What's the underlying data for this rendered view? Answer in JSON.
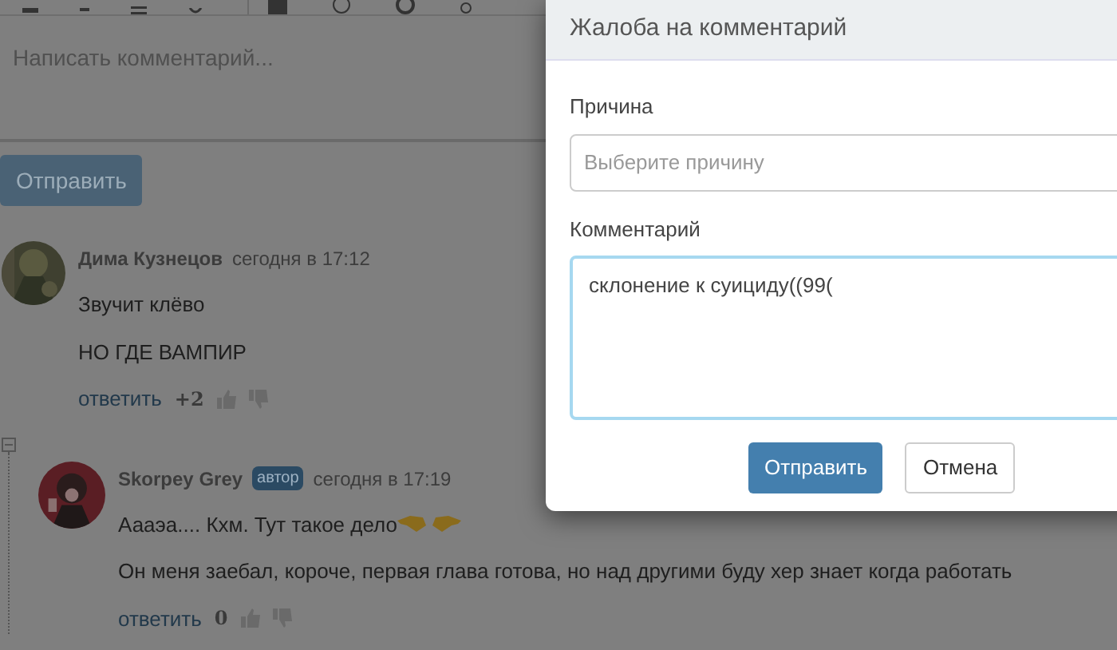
{
  "editor": {
    "placeholder": "Написать комментарий...",
    "submit": "Отправить"
  },
  "comments": [
    {
      "author": "Дима Кузнецов",
      "time": "сегодня в 17:12",
      "lines": [
        "Звучит клёво",
        "НО ГДЕ ВАМПИР"
      ],
      "reply": "ответить",
      "score": "+2",
      "expanded": true,
      "children": [
        {
          "author": "Skorpey Grey",
          "badge": "автор",
          "time": "сегодня в 17:19",
          "lines": [
            "Аааэа.... Кхм. Тут такое дело",
            "Он меня заебал, короче, первая глава готова, но над другими буду хер знает когда работать"
          ],
          "emoji": true,
          "reply": "ответить",
          "score": "0"
        }
      ]
    }
  ],
  "dialog": {
    "title": "Жалоба на комментарий",
    "fields": [
      {
        "kind": "select",
        "label": "Причина",
        "placeholder": "Выберите причину"
      },
      {
        "kind": "textarea",
        "label": "Комментарий",
        "value": "склонение к суициду((99(",
        "focused": true
      }
    ],
    "buttons": [
      {
        "label": "Отправить",
        "kind": "primary"
      },
      {
        "label": "Отмена",
        "kind": "default"
      }
    ]
  }
}
